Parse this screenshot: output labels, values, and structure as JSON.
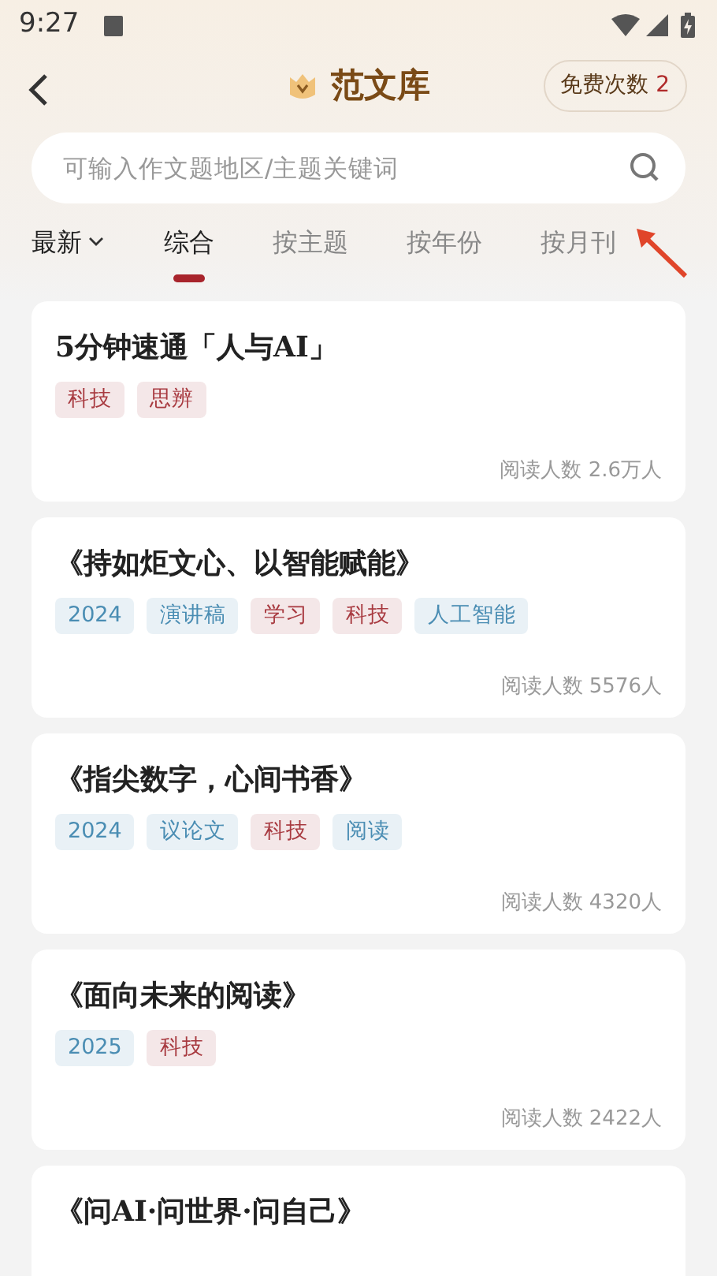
{
  "status_bar": {
    "time": "9:27"
  },
  "header": {
    "title": "范文库",
    "quota_label": "免费次数",
    "quota_value": "2"
  },
  "search": {
    "placeholder": "可输入作文题地区/主题关键词"
  },
  "sort": {
    "label": "最新"
  },
  "tabs": [
    {
      "label": "综合",
      "selected": true
    },
    {
      "label": "按主题",
      "selected": false
    },
    {
      "label": "按年份",
      "selected": false
    },
    {
      "label": "按月刊",
      "selected": false
    }
  ],
  "articles": [
    {
      "title": "5分钟速通「人与AI」",
      "tags": [
        {
          "text": "科技",
          "color": "#a83a40"
        },
        {
          "text": "思辨",
          "color": "#a83a40"
        }
      ],
      "readers": "阅读人数 2.6万人"
    },
    {
      "title": "《持如炬文心、以智能赋能》",
      "tags": [
        {
          "text": "2024",
          "color": "#4a8db3"
        },
        {
          "text": "演讲稿",
          "color": "#4a8db3"
        },
        {
          "text": "学习",
          "color": "#a83a40"
        },
        {
          "text": "科技",
          "color": "#a83a40"
        },
        {
          "text": "人工智能",
          "color": "#4a8db3"
        }
      ],
      "readers": "阅读人数 5576人"
    },
    {
      "title": "《指尖数字，心间书香》",
      "tags": [
        {
          "text": "2024",
          "color": "#4a8db3"
        },
        {
          "text": "议论文",
          "color": "#4a8db3"
        },
        {
          "text": "科技",
          "color": "#a83a40"
        },
        {
          "text": "阅读",
          "color": "#4a8db3"
        }
      ],
      "readers": "阅读人数 4320人"
    },
    {
      "title": "《面向未来的阅读》",
      "tags": [
        {
          "text": "2025",
          "color": "#4a8db3"
        },
        {
          "text": "科技",
          "color": "#a83a40"
        }
      ],
      "readers": "阅读人数 2422人"
    },
    {
      "title": "《问AI·问世界·问自己》"
    }
  ]
}
